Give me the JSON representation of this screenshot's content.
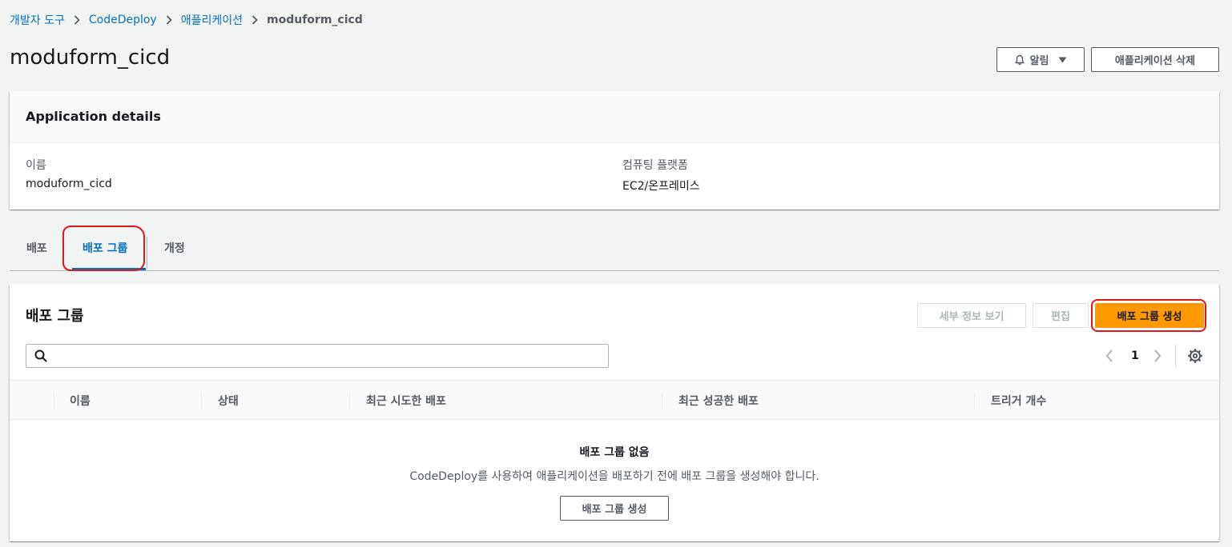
{
  "breadcrumb": {
    "items": [
      "개발자 도구",
      "CodeDeploy",
      "애플리케이션"
    ],
    "current": "moduform_cicd"
  },
  "page": {
    "title": "moduform_cicd"
  },
  "header_buttons": {
    "alarm_label": "알림",
    "delete_label": "애플리케이션 삭제"
  },
  "details": {
    "title": "Application details",
    "name_label": "이름",
    "name_value": "moduform_cicd",
    "platform_label": "컴퓨팅 플랫폼",
    "platform_value": "EC2/온프레미스"
  },
  "tabs": [
    {
      "label": "배포"
    },
    {
      "label": "배포 그룹",
      "active": true
    },
    {
      "label": "개정"
    }
  ],
  "deployment_groups": {
    "title": "배포 그룹",
    "view_details_label": "세부 정보 보기",
    "edit_label": "편집",
    "create_label": "배포 그룹 생성",
    "search_placeholder": "",
    "page_number": "1",
    "columns": [
      "이름",
      "상태",
      "최근 시도한 배포",
      "최근 성공한 배포",
      "트리거 개수"
    ],
    "empty_title": "배포 그룹 없음",
    "empty_desc": "CodeDeploy를 사용하여 애플리케이션을 배포하기 전에 배포 그룹을 생성해야 합니다.",
    "empty_create_label": "배포 그룹 생성"
  },
  "colors": {
    "link": "#0073bb",
    "primary": "#ff9900",
    "annotation": "#e0171b"
  }
}
